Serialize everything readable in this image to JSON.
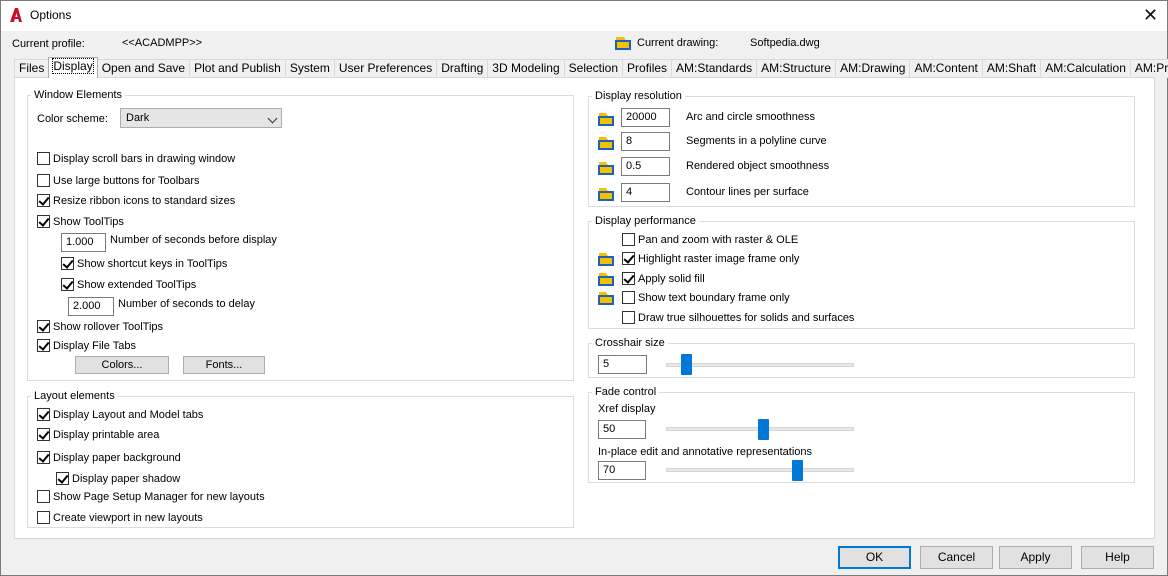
{
  "window": {
    "title": "Options",
    "close_label": "✕"
  },
  "profile": {
    "label": "Current profile:",
    "value": "<<ACADMPP>>"
  },
  "drawing": {
    "label": "Current drawing:",
    "value": "Softpedia.dwg"
  },
  "tabs": [
    "Files",
    "Display",
    "Open and Save",
    "Plot and Publish",
    "System",
    "User Preferences",
    "Drafting",
    "3D Modeling",
    "Selection",
    "Profiles",
    "AM:Standards",
    "AM:Structure",
    "AM:Drawing",
    "AM:Content",
    "AM:Shaft",
    "AM:Calculation",
    "AM:Preferences"
  ],
  "active_tab": "Display",
  "window_elements": {
    "legend": "Window Elements",
    "color_scheme_label": "Color scheme:",
    "color_scheme_value": "Dark",
    "scroll_bars": "Display scroll bars in drawing window",
    "large_buttons": "Use large buttons for Toolbars",
    "resize_ribbon": "Resize ribbon icons to standard sizes",
    "show_tooltips": "Show ToolTips",
    "seconds_before_value": "1.000",
    "seconds_before_label": "Number of seconds before display",
    "shortcut_keys": "Show shortcut keys in ToolTips",
    "extended_tooltips": "Show extended ToolTips",
    "seconds_delay_value": "2.000",
    "seconds_delay_label": "Number of seconds to delay",
    "rollover_tooltips": "Show rollover ToolTips",
    "file_tabs": "Display File Tabs",
    "colors_button": "Colors...",
    "fonts_button": "Fonts..."
  },
  "layout_elements": {
    "legend": "Layout elements",
    "layout_model_tabs": "Display Layout and Model tabs",
    "printable_area": "Display printable area",
    "paper_background": "Display paper background",
    "paper_shadow": "Display paper shadow",
    "page_setup_manager": "Show Page Setup Manager for new layouts",
    "create_viewport": "Create viewport in new layouts"
  },
  "display_resolution": {
    "legend": "Display resolution",
    "arc_value": "20000",
    "arc_label": "Arc and circle smoothness",
    "segments_value": "8",
    "segments_label": "Segments in a polyline curve",
    "rendered_value": "0.5",
    "rendered_label": "Rendered object smoothness",
    "contour_value": "4",
    "contour_label": "Contour lines per surface"
  },
  "display_performance": {
    "legend": "Display performance",
    "pan_zoom": "Pan and zoom with raster & OLE",
    "highlight_raster": "Highlight raster image frame only",
    "apply_solid_fill": "Apply solid fill",
    "text_boundary": "Show text boundary frame only",
    "true_silhouettes": "Draw true silhouettes for solids and surfaces"
  },
  "crosshair": {
    "legend": "Crosshair size",
    "value": "5",
    "level_percent": 5
  },
  "fade_control": {
    "legend": "Fade control",
    "xref_label": "Xref display",
    "xref_value": "50",
    "xref_level_percent": 50,
    "inplace_label": "In-place edit and annotative representations",
    "inplace_value": "70",
    "inplace_level_percent": 70
  },
  "footer": {
    "ok": "OK",
    "cancel": "Cancel",
    "apply": "Apply",
    "help": "Help"
  },
  "colors": {
    "accent": "#0078d7",
    "app_icon": "#c8102e"
  }
}
